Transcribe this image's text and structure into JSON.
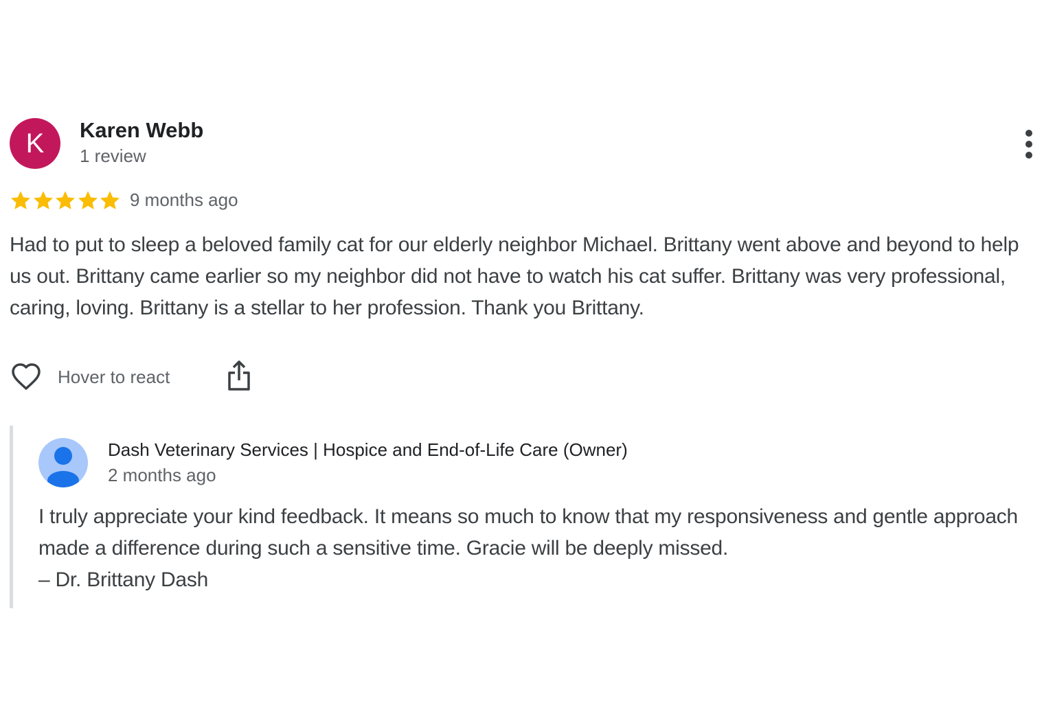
{
  "review": {
    "avatar_letter": "K",
    "avatar_color": "#c2185b",
    "reviewer_name": "Karen Webb",
    "reviewer_meta": "1 review",
    "rating": 5,
    "rating_max": 5,
    "star_color": "#fbbc04",
    "date": "9 months ago",
    "text": "Had to put to sleep a beloved family cat for our elderly neighbor Michael. Brittany went above and beyond to help us out. Brittany came earlier so my neighbor did not have to watch his cat suffer. Brittany was very professional, caring, loving. Brittany is a stellar to her profession. Thank you Brittany.",
    "more_icon": "more-vert-icon"
  },
  "actions": {
    "react_icon": "heart-outline-icon",
    "react_label": "Hover to react",
    "share_icon": "share-icon"
  },
  "owner_reply": {
    "avatar_icon": "person-icon",
    "name": "Dash Veterinary Services | Hospice and End-of-Life Care (Owner)",
    "date": "2 months ago",
    "text_lines": [
      "I truly appreciate your kind feedback. It means so much to know that my responsiveness and gentle approach made a difference during such a sensitive time. Gracie will be deeply missed.",
      "– Dr. Brittany Dash"
    ]
  }
}
